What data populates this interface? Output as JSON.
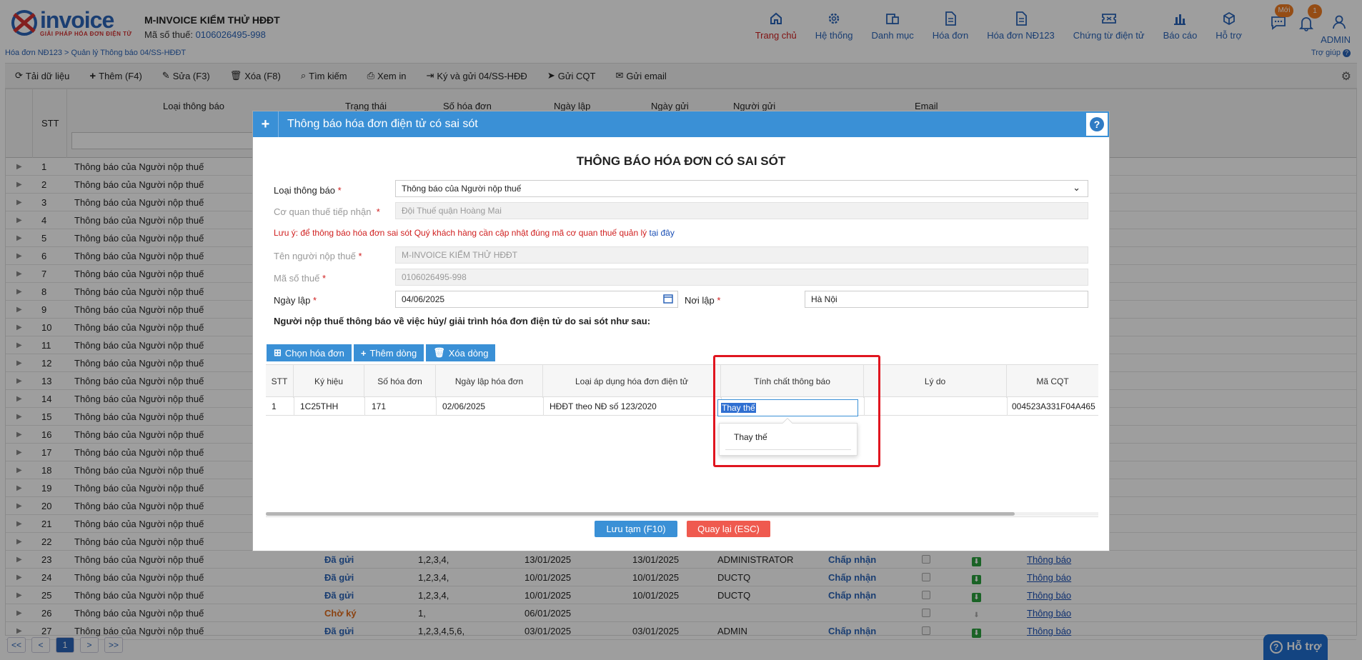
{
  "brand": {
    "logo_text": "invoice",
    "logo_sub": "GIẢI PHÁP HÓA ĐƠN ĐIỆN TỬ",
    "accent": "#2b64b8"
  },
  "company": {
    "name": "M-INVOICE KIỂM THỬ HĐĐT",
    "tax_label": "Mã số thuế:",
    "tax_value": "0106026495-998"
  },
  "breadcrumb": "Hóa đơn NĐ123 > Quản lý Thông báo 04/SS-HĐĐT",
  "nav": [
    {
      "label": "Trang chủ",
      "icon": "home-icon"
    },
    {
      "label": "Hệ thống",
      "icon": "gear-icon"
    },
    {
      "label": "Danh mục",
      "icon": "catalog-icon"
    },
    {
      "label": "Hóa đơn",
      "icon": "document-icon"
    },
    {
      "label": "Hóa đơn NĐ123",
      "icon": "document-icon"
    },
    {
      "label": "Chứng từ điện tử",
      "icon": "ticket-icon"
    },
    {
      "label": "Báo cáo",
      "icon": "chart-icon"
    },
    {
      "label": "Hỗ trợ",
      "icon": "cube-icon"
    }
  ],
  "user": {
    "name": "ADMIN",
    "help": "Trợ giúp",
    "new_badge": "Mới",
    "notif_count": "1"
  },
  "toolbar": {
    "reload": "Tải dữ liệu",
    "add": "Thêm (F4)",
    "edit": "Sửa (F3)",
    "delete": "Xóa (F8)",
    "search": "Tìm kiếm",
    "print": "Xem in",
    "sign_send": "Ký và gửi 04/SS-HĐĐ",
    "send_cqt": "Gửi CQT",
    "send_email": "Gửi email"
  },
  "grid": {
    "headers": {
      "stt": "STT",
      "type": "Loại thông báo",
      "status": "Trạng thái",
      "invoice_no": "Số hóa đơn",
      "date": "Ngày lập",
      "sent_date": "Ngày gửi",
      "sender": "Người gửi",
      "email": "Email"
    },
    "row_label": "Thông báo của Người nộp thuế",
    "numbers": [
      "1",
      "2",
      "3",
      "4",
      "5",
      "6",
      "7",
      "8",
      "9",
      "10",
      "11",
      "12",
      "13",
      "14",
      "15",
      "16",
      "17",
      "18",
      "19",
      "20",
      "21",
      "22"
    ],
    "detail_rows": [
      {
        "stt": "23",
        "status": "Đã gửi",
        "status_kind": "sent",
        "inv": "1,2,3,4,",
        "date": "13/01/2025",
        "sent": "13/01/2025",
        "sender": "ADMINISTRATOR",
        "result": "Chấp nhận",
        "dl": true,
        "link": "Thông báo"
      },
      {
        "stt": "24",
        "status": "Đã gửi",
        "status_kind": "sent",
        "inv": "1,2,3,4,",
        "date": "10/01/2025",
        "sent": "10/01/2025",
        "sender": "DUCTQ",
        "result": "Chấp nhận",
        "dl": true,
        "link": "Thông báo"
      },
      {
        "stt": "25",
        "status": "Đã gửi",
        "status_kind": "sent",
        "inv": "1,2,3,4,",
        "date": "10/01/2025",
        "sent": "10/01/2025",
        "sender": "DUCTQ",
        "result": "Chấp nhận",
        "dl": true,
        "link": "Thông báo"
      },
      {
        "stt": "26",
        "status": "Chờ ký",
        "status_kind": "wait",
        "inv": "1,",
        "date": "06/01/2025",
        "sent": "",
        "sender": "",
        "result": "",
        "dl": false,
        "link": "Thông báo"
      },
      {
        "stt": "27",
        "status": "Đã gửi",
        "status_kind": "sent",
        "inv": "1,2,3,4,5,6,",
        "date": "03/01/2025",
        "sent": "03/01/2025",
        "sender": "ADMIN",
        "result": "Chấp nhận",
        "dl": true,
        "link": "Thông báo"
      }
    ]
  },
  "pager": {
    "first": "<<",
    "prev": "<",
    "current": "1",
    "next": ">",
    "last": ">>"
  },
  "help_button": "Hỗ trợ",
  "modal": {
    "title": "Thông báo hóa đơn điện tử có sai sót",
    "heading": "THÔNG BÁO HÓA ĐƠN CÓ SAI SÓT",
    "fields": {
      "type_label": "Loại thông báo",
      "type_value": "Thông báo của Người nộp thuế",
      "tax_office_label": "Cơ quan thuế tiếp nhận",
      "tax_office_value": "Đội Thuế quận Hoàng Mai",
      "note": "Lưu ý: để thông báo hóa đơn sai sót Quý khách hàng cần cập nhật đúng mã cơ quan thuế quản lý",
      "note_link": "tại đây",
      "taxpayer_label": "Tên người nộp thuế",
      "taxpayer_value": "M-INVOICE KIỂM THỬ HĐĐT",
      "tax_code_label": "Mã số thuế",
      "tax_code_value": "0106026495-998",
      "date_label": "Ngày lập",
      "date_value": "04/06/2025",
      "place_label": "Nơi lập",
      "place_value": "Hà Nội"
    },
    "sub_title": "Người nộp thuế thông báo về việc hủy/ giải trình hóa đơn điện tử do sai sót như sau:",
    "actions": {
      "choose": "Chọn hóa đơn",
      "add_row": "Thêm dòng",
      "del_row": "Xóa dòng"
    },
    "table": {
      "headers": [
        "STT",
        "Ký hiệu",
        "Số hóa đơn",
        "Ngày lập hóa đơn",
        "Loại áp dụng hóa đơn điện tử",
        "Tính chất thông báo",
        "Lý do",
        "Mã CQT"
      ],
      "row": {
        "stt": "1",
        "symbol": "1C25THH",
        "number": "171",
        "date": "02/06/2025",
        "type": "HĐĐT theo NĐ số 123/2020",
        "nature": "Thay thế",
        "reason": "",
        "cqt": "004523A331F04A465"
      }
    },
    "dropdown_option": "Thay thế",
    "buttons": {
      "save": "Lưu tạm (F10)",
      "back": "Quay lại (ESC)"
    }
  }
}
